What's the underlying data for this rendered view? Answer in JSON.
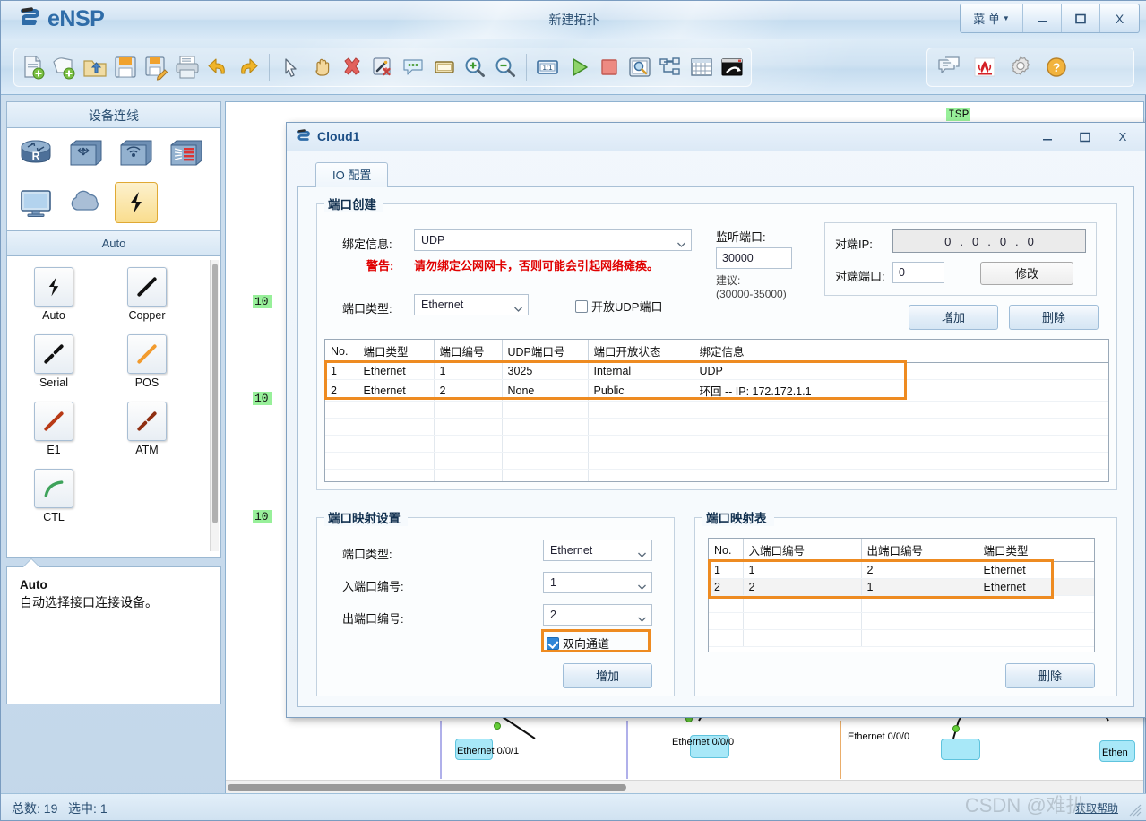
{
  "app": {
    "brand": "eNSP",
    "window_title": "新建拓扑",
    "menu_label": "菜 单",
    "minimize": "_",
    "maximize": "❐",
    "close": "X"
  },
  "toolbar": {
    "group1": [
      {
        "name": "new-topology-icon",
        "title": "新建拓扑"
      },
      {
        "name": "new-blank-icon",
        "title": "新建"
      },
      {
        "name": "open-folder-icon",
        "title": "打开"
      },
      {
        "name": "save-icon",
        "title": "保存"
      },
      {
        "name": "save-as-icon",
        "title": "另存为"
      },
      {
        "name": "print-icon",
        "title": "打印"
      },
      {
        "name": "undo-icon",
        "title": "撤销"
      },
      {
        "name": "redo-icon",
        "title": "恢复"
      },
      {
        "name": "select-pointer-icon",
        "title": "选择"
      },
      {
        "name": "pan-hand-icon",
        "title": "移动"
      },
      {
        "name": "delete-x-icon",
        "title": "删除"
      },
      {
        "name": "delete-link-icon",
        "title": "删除连线"
      },
      {
        "name": "text-balloon-icon",
        "title": "文本"
      },
      {
        "name": "rectangle-icon",
        "title": "图形"
      },
      {
        "name": "zoom-in-icon",
        "title": "放大"
      },
      {
        "name": "zoom-out-icon",
        "title": "缩小"
      },
      {
        "name": "zoom-reset-icon",
        "title": "1:1"
      },
      {
        "name": "start-device-icon",
        "title": "开启设备"
      },
      {
        "name": "stop-device-icon",
        "title": "关闭设备"
      },
      {
        "name": "capture-packet-icon",
        "title": "数据抓包"
      },
      {
        "name": "topology-tree-icon",
        "title": "拓扑树"
      },
      {
        "name": "grid-icon",
        "title": "网格"
      },
      {
        "name": "console-icon",
        "title": "命令行"
      }
    ],
    "group2": [
      {
        "name": "feedback-icon",
        "title": "意见反馈"
      },
      {
        "name": "huawei-logo-icon",
        "title": "华为"
      },
      {
        "name": "settings-gear-icon",
        "title": "选项"
      },
      {
        "name": "help-question-icon",
        "title": "帮助"
      }
    ],
    "zoom_label": "1:1"
  },
  "sidebar": {
    "panel_title": "设备连线",
    "devices": [
      {
        "name": "router-icon",
        "label": "路由器"
      },
      {
        "name": "switch-icon",
        "label": "交换机"
      },
      {
        "name": "wlan-icon",
        "label": "无线局域网"
      },
      {
        "name": "firewall-icon",
        "label": "防火墙"
      },
      {
        "name": "endpoint-icon",
        "label": "终端"
      },
      {
        "name": "cloud-icon",
        "label": "其他设备"
      },
      {
        "name": "link-icon",
        "label": "设备连线"
      }
    ],
    "selected_device_index": 6,
    "subpanel_title": "Auto",
    "links": [
      {
        "label": "Auto",
        "icon": "auto-link-icon",
        "color": "#111111"
      },
      {
        "label": "Copper",
        "icon": "copper-link-icon",
        "color": "#111111"
      },
      {
        "label": "Serial",
        "icon": "serial-link-icon",
        "color": "#111111"
      },
      {
        "label": "POS",
        "icon": "pos-link-icon",
        "color": "#f29b2e"
      },
      {
        "label": "E1",
        "icon": "e1-link-icon",
        "color": "#b83a16"
      },
      {
        "label": "ATM",
        "icon": "atm-link-icon",
        "color": "#8f2f12"
      },
      {
        "label": "CTL",
        "icon": "ctl-link-icon",
        "color": "#3ea35b"
      }
    ],
    "tooltip": {
      "title": "Auto",
      "body": "自动选择接口连接设备。"
    }
  },
  "canvas": {
    "isp_label": "ISP",
    "ip_labels": [
      "10",
      "10",
      "10"
    ],
    "interfaces": [
      "Ethernet 0/0/1",
      "Ethernet 0/0/0",
      "Ethernet 0/0/0",
      "Ethen"
    ]
  },
  "statusbar": {
    "total_label": "总数:",
    "total_value": "19",
    "selected_label": "选中:",
    "selected_value": "1",
    "help_link": "获取帮助",
    "watermark": "CSDN @难扒..."
  },
  "dialog": {
    "title": "Cloud1",
    "icon": "cloud-device-icon",
    "minimize": "_",
    "maximize": "❐",
    "close": "X",
    "tab_label": "IO 配置",
    "port_create": {
      "group_title": "端口创建",
      "binding_label": "绑定信息:",
      "binding_value": "UDP",
      "warning_label": "警告:",
      "warning_text": "请勿绑定公网网卡，否则可能会引起网络瘫痪。",
      "port_type_label": "端口类型:",
      "port_type_value": "Ethernet",
      "open_udp_label": "开放UDP端口",
      "open_udp_checked": false,
      "listen_port_label": "监听端口:",
      "listen_port_value": "30000",
      "suggest_label": "建议:",
      "suggest_range": "(30000-35000)",
      "peer_ip_label": "对端IP:",
      "peer_ip_octets": [
        "0",
        "0",
        "0",
        "0"
      ],
      "peer_port_label": "对端端口:",
      "peer_port_value": "0",
      "modify_button": "修改",
      "add_button": "增加",
      "delete_button": "删除"
    },
    "port_table": {
      "columns": [
        "No.",
        "端口类型",
        "端口编号",
        "UDP端口号",
        "端口开放状态",
        "绑定信息"
      ],
      "rows": [
        [
          "1",
          "Ethernet",
          "1",
          "3025",
          "Internal",
          "UDP"
        ],
        [
          "2",
          "Ethernet",
          "2",
          "None",
          "Public",
          "环回 -- IP: 172.172.1.1"
        ]
      ],
      "empty_rows": 5,
      "highlight_color": "#ee8b21"
    },
    "port_mapping_settings": {
      "group_title": "端口映射设置",
      "port_type_label": "端口类型:",
      "port_type_value": "Ethernet",
      "in_port_label": "入端口编号:",
      "in_port_value": "1",
      "out_port_label": "出端口编号:",
      "out_port_value": "2",
      "bidirectional_label": "双向通道",
      "bidirectional_checked": true,
      "add_button": "增加"
    },
    "port_mapping_table": {
      "group_title": "端口映射表",
      "columns": [
        "No.",
        "入端口编号",
        "出端口编号",
        "端口类型"
      ],
      "rows": [
        [
          "1",
          "1",
          "2",
          "Ethernet"
        ],
        [
          "2",
          "2",
          "1",
          "Ethernet"
        ]
      ],
      "empty_rows": 3,
      "delete_button": "删除"
    }
  },
  "colors": {
    "accent_orange": "#ee8b21",
    "warning_red": "#e00000",
    "title_blue": "#2f6ca8",
    "green_highlight": "#98f09a"
  }
}
